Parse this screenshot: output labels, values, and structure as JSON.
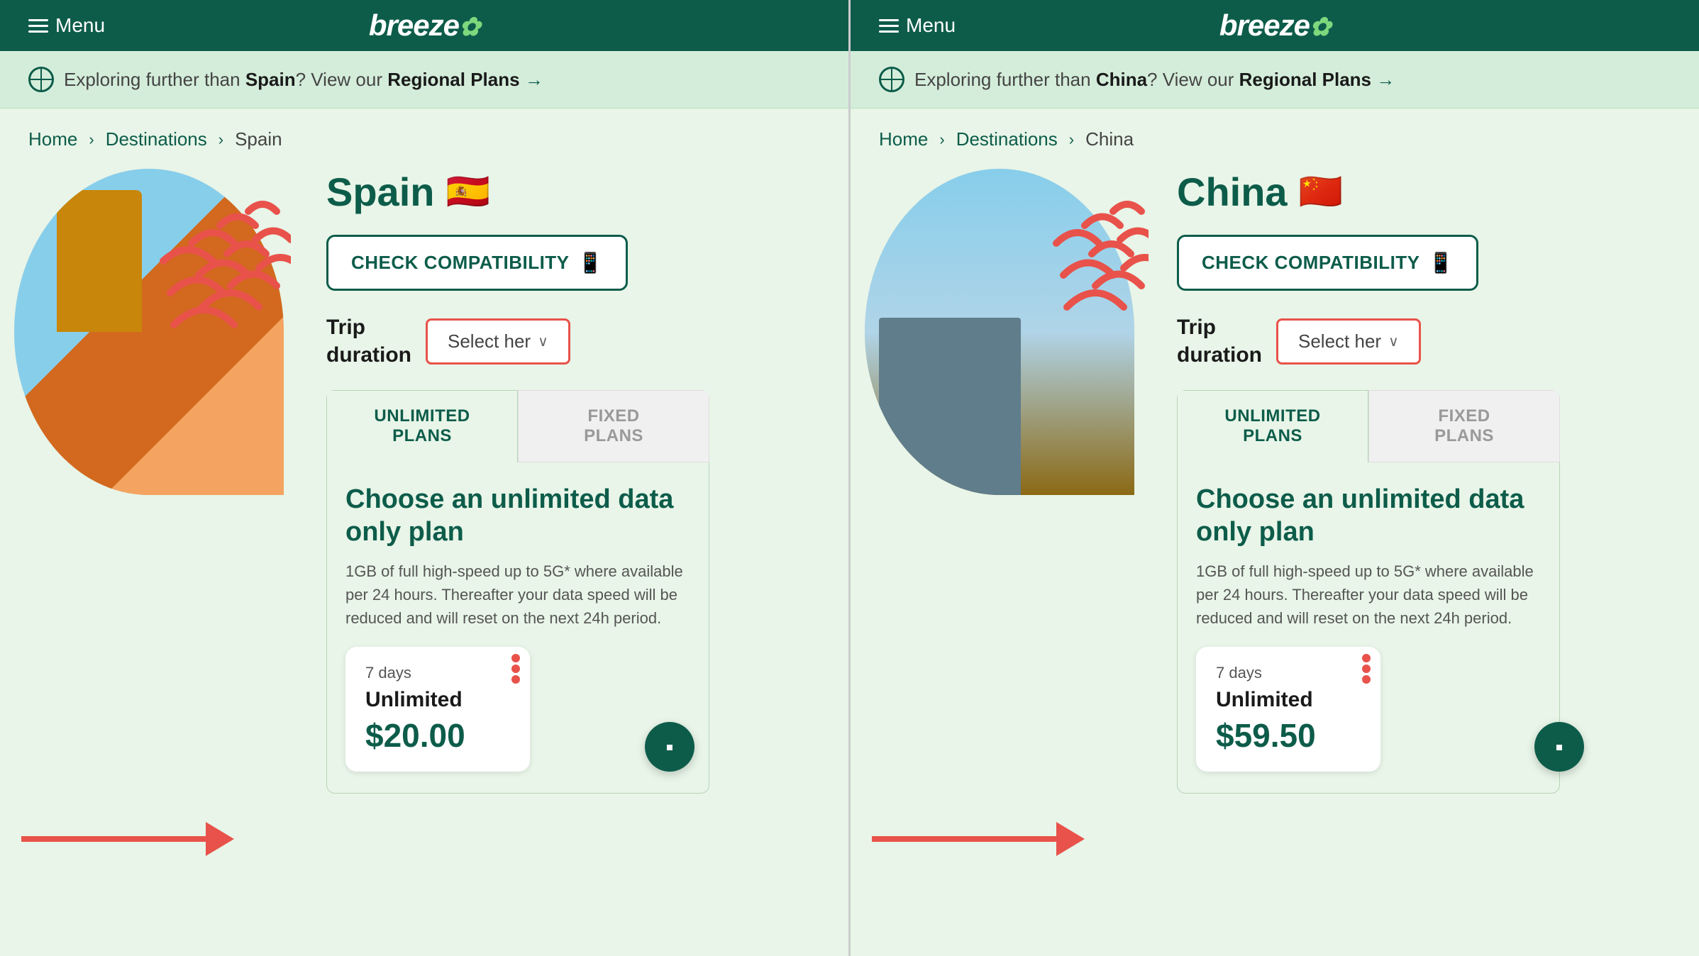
{
  "panels": [
    {
      "id": "spain-panel",
      "nav": {
        "menu_label": "Menu",
        "logo": "breeze"
      },
      "banner": {
        "text_prefix": "Exploring further than ",
        "country_bold": "Spain",
        "text_middle": "? View our ",
        "link_text": "Regional Plans",
        "arrow": "→"
      },
      "breadcrumb": {
        "home": "Home",
        "destinations": "Destinations",
        "current": "Spain"
      },
      "destination": {
        "title": "Spain",
        "flag": "🇪🇸",
        "check_compat_label": "CHECK COMPATIBILITY",
        "trip_label": "Trip\nduration",
        "select_label": "Select her",
        "tabs": [
          {
            "label": "UNLIMITED\nPLANS",
            "active": true
          },
          {
            "label": "FIXED\nPLANS",
            "active": false
          }
        ],
        "plan_title": "Choose an unlimited data only plan",
        "plan_desc": "1GB of full high-speed up to 5G* where available per 24 hours. Thereafter your data speed will be reduced and will reset on the next 24h period.",
        "price_card": {
          "days": "7 days",
          "plan": "Unlimited",
          "amount": "$20.00"
        }
      }
    },
    {
      "id": "china-panel",
      "nav": {
        "menu_label": "Menu",
        "logo": "breeze"
      },
      "banner": {
        "text_prefix": "Exploring further than ",
        "country_bold": "China",
        "text_middle": "? View our ",
        "link_text": "Regional Plans",
        "arrow": "→"
      },
      "breadcrumb": {
        "home": "Home",
        "destinations": "Destinations",
        "current": "China"
      },
      "destination": {
        "title": "China",
        "flag": "🇨🇳",
        "check_compat_label": "CHECK COMPATIBILITY",
        "trip_label": "Trip\nduration",
        "select_label": "Select her",
        "tabs": [
          {
            "label": "UNLIMITED\nPLANS",
            "active": true
          },
          {
            "label": "FIXED\nPLANS",
            "active": false
          }
        ],
        "plan_title": "Choose an unlimited data only plan",
        "plan_desc": "1GB of full high-speed up to 5G* where available per 24 hours. Thereafter your data speed will be reduced and will reset on the next 24h period.",
        "price_card": {
          "days": "7 days",
          "plan": "Unlimited",
          "amount": "$59.50"
        }
      }
    }
  ]
}
